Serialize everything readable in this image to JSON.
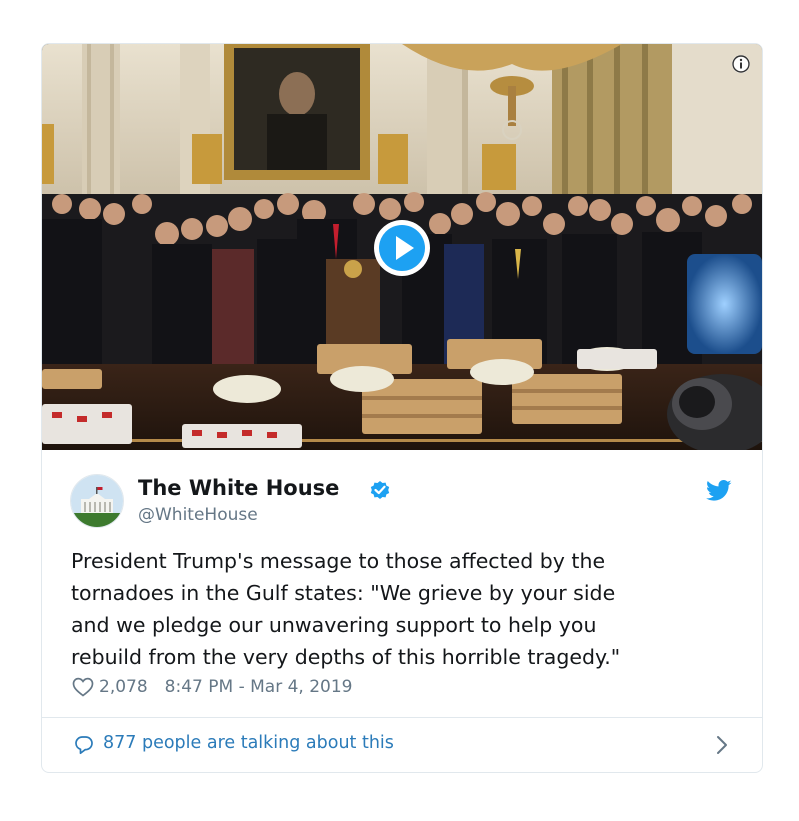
{
  "tweet": {
    "display_name": "The White House",
    "handle": "@WhiteHouse",
    "verified": true,
    "text": "President Trump's message to those affected by the\ntornadoes in the Gulf states: \"We grieve by your side\nand we pledge our unwavering support to help you\nrebuild from the very depths of this horrible tragedy.\"",
    "like_count": "2,078",
    "timestamp": "8:47 PM - Mar 4, 2019"
  },
  "footer": {
    "talking_text": "877 people are talking about this"
  },
  "icons": {
    "info": "info-icon",
    "play": "play-icon",
    "verified": "verified-badge-icon",
    "bird": "twitter-bird-icon",
    "heart": "heart-icon",
    "bubble": "speech-bubble-icon",
    "chevron": "chevron-right-icon"
  },
  "colors": {
    "brand_blue": "#1da1f2",
    "link_blue": "#2b7bb9",
    "secondary_text": "#657786",
    "border": "#e1e8ed"
  }
}
